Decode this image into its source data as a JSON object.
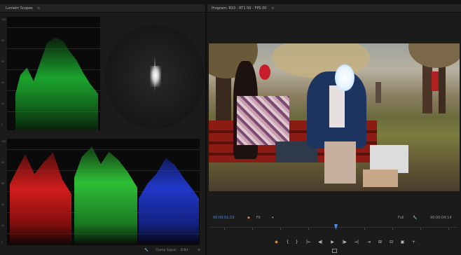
{
  "lumetri_panel": {
    "tab_title": "Lumetri Scopes",
    "menu_glyph": "≡",
    "footer": {
      "wrench_glyph": "🔧",
      "clamp_label": "Clamp Signal",
      "bit_depth": "8 Bit",
      "menu_glyph": "≡"
    },
    "luma_scale": [
      "100",
      "90",
      "80",
      "70",
      "60",
      "50",
      "40",
      "30",
      "20",
      "10",
      "0"
    ],
    "parade_scale": [
      "100",
      "90",
      "80",
      "70",
      "60",
      "50",
      "40",
      "30",
      "20",
      "10",
      "0"
    ]
  },
  "program_panel": {
    "tab_title": "Program: RS3 - RT1 00 - FPS 00",
    "menu_glyph": "≡",
    "timecode_current": "00;00;01;10",
    "timecode_duration": "00;00;04;14",
    "fit_label": "Fit",
    "quality_label": "Full",
    "controls": [
      "◆",
      "{",
      "}",
      "|←",
      "◀|",
      "▶",
      "|▶",
      "→|",
      "⇥",
      "⊞",
      "⊟",
      "▣",
      "+"
    ]
  },
  "colors": {
    "accent_blue": "#4a8fe7",
    "marker_orange": "#e58a2a"
  }
}
